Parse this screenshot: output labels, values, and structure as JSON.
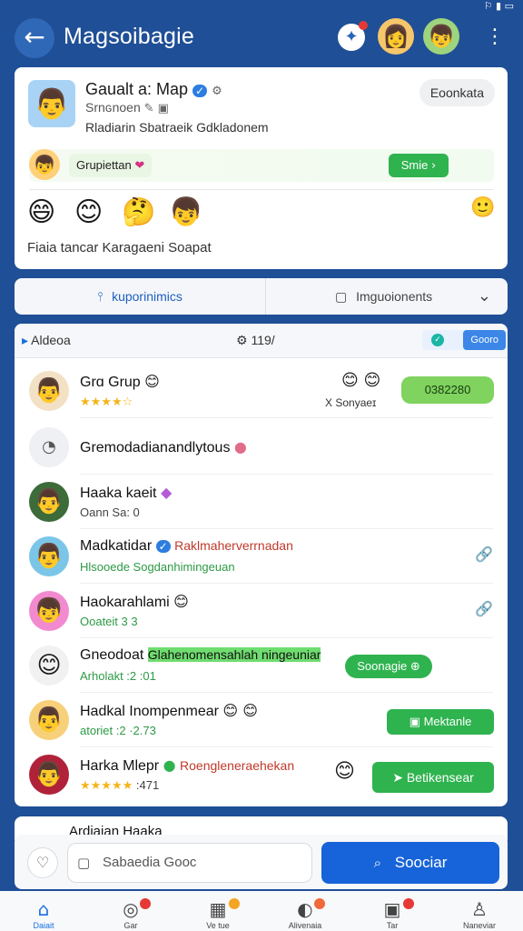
{
  "status_bar": {
    "icons": "⚐ ▮ ▭"
  },
  "header": {
    "title": "Magsoibagie",
    "back_icon": "←",
    "notif_icon": "✦",
    "menu_icon": "⋮"
  },
  "group_card": {
    "avatar_icon": "👨",
    "title": "Gaualt a: Map",
    "subtitle": "Srnɢnoen",
    "meta": "Rladiarin  Sbatraeik  Gdkladonem",
    "connect_label": "Eoonkata",
    "group_label": "Grupiettan",
    "group_button": "Smie",
    "emojis": [
      "😄",
      "😊",
      "🤔",
      "👦",
      "🙂"
    ],
    "caption": "Fiaia tancar Karagaeni Soapat"
  },
  "tabs": [
    {
      "label": "kuporinimics",
      "icon": "⫯"
    },
    {
      "label": "Imguoionents",
      "icon": "▢"
    }
  ],
  "tab_chevron": "⌄",
  "list_toolbar": {
    "left_label": "Aldeoa",
    "mid_label": "119/",
    "right_label": "Gooro"
  },
  "items": [
    {
      "avatar": "👨",
      "name": "Grɑ Grup",
      "stars": "★★★★☆",
      "right_text": "X Sonyaeɪ",
      "button": "0382280"
    },
    {
      "avatar": "◔",
      "name": "Gremodadianandlytous"
    },
    {
      "avatar": "👨",
      "name": "Haaka kaeit",
      "sub": "Oann Sa: 0"
    },
    {
      "avatar": "👨",
      "name": "Madkatidar",
      "name_extra": "Raklmaherverrnadan",
      "sub": "Hlsooede Sogdanhimingeuan"
    },
    {
      "avatar": "👦",
      "name": "Haokarahlami",
      "sub": "Ooateit 3  3"
    },
    {
      "avatar": "😊",
      "name": "Gneodoat",
      "name_extra": "Glahenomensahlah ningeuniar",
      "sub": "Arholakt :2 :01",
      "button": "Soonagie"
    },
    {
      "avatar": "👨",
      "name": "Hadkal Inompenmear",
      "sub": "atoriet :2 ·2.73",
      "button": "Mektanle"
    },
    {
      "avatar": "👨",
      "name": "Harka Mlepr",
      "name_extra": "Roengleneraehekan",
      "stars": "★★★★★",
      "sub": ":471",
      "button": "Betikensear"
    }
  ],
  "peek_card": {
    "title": "Ardiaian Haaka"
  },
  "compose": {
    "heart_icon": "♡",
    "placeholder": "Sabaedia Gooc",
    "input_icon": "▢",
    "button_label": "Soociar",
    "button_icon": "⌕"
  },
  "bottom_nav": [
    {
      "icon": "⌂",
      "label": "Daiait"
    },
    {
      "icon": "◎",
      "label": "Gar"
    },
    {
      "icon": "▦",
      "label": "Ve tue"
    },
    {
      "icon": "◐",
      "label": "Alivenaia"
    },
    {
      "icon": "▣",
      "label": "Tar"
    },
    {
      "icon": "♙",
      "label": "Naneviar"
    }
  ],
  "colors": {
    "primary": "#1763d9",
    "header_bg": "#1f4f96",
    "accent_green": "#2fb34f"
  }
}
